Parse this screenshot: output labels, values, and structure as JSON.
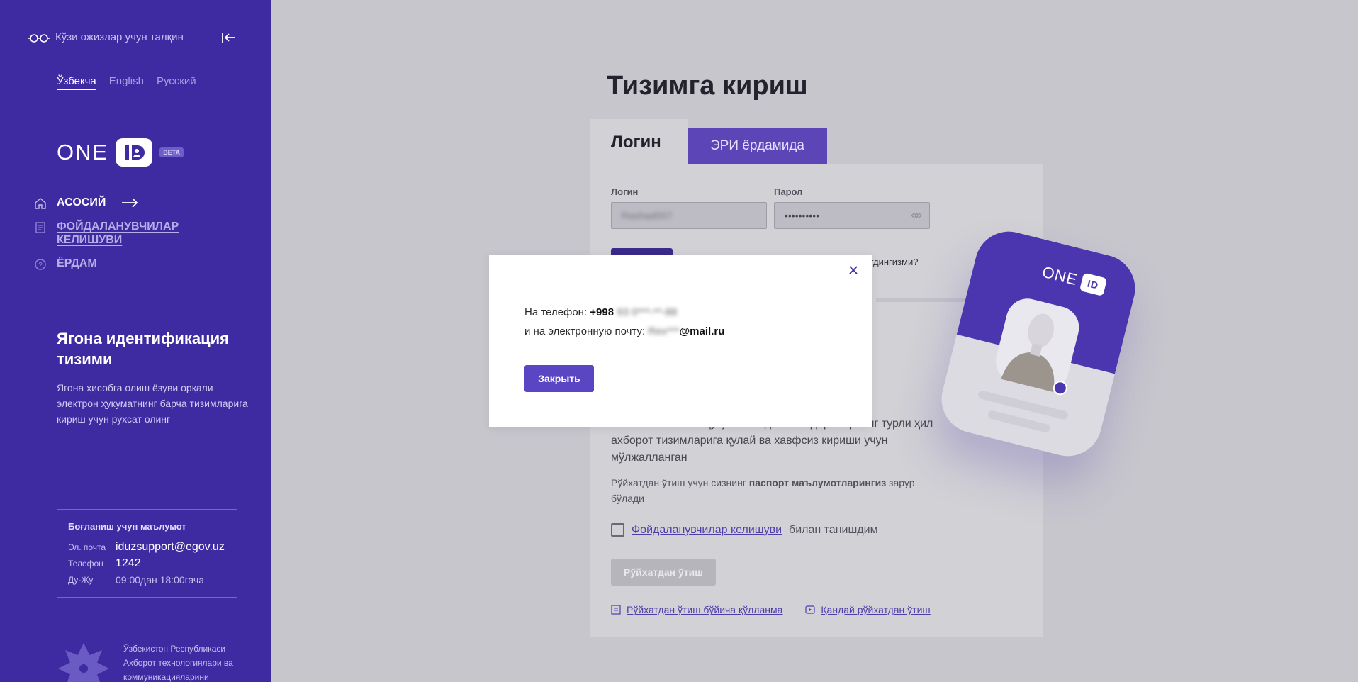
{
  "sidebar": {
    "accessibility_label": "Кўзи ожизлар учун талқин",
    "languages": [
      "Ўзбекча",
      "English",
      "Русский"
    ],
    "logo": {
      "text": "ONE",
      "badge": "BETA"
    },
    "nav": [
      {
        "label": "АСОСИЙ"
      },
      {
        "label": "ФОЙДАЛАНУВЧИЛАР КЕЛИШУВИ"
      },
      {
        "label": "ЁРДАМ"
      }
    ],
    "system_title": "Ягона идентификация тизими",
    "system_desc": "Ягона ҳисобга олиш ёзуви орқали электрон ҳукуматнинг барча тизимларига кириш учун рухсат олинг",
    "contact": {
      "title": "Боғланиш учун маълумот",
      "email_label": "Эл. почта",
      "email": "iduzsupport@egov.uz",
      "phone_label": "Телефон",
      "phone": "1242",
      "hours_label": "Ду-Жу",
      "hours": "09:00дан 18:00гача"
    },
    "ministry_text": "Ўзбекистон Республикаси Ахборот технологиялари ва коммуникацияларини"
  },
  "main": {
    "title": "Тизимга кириш",
    "tabs": [
      {
        "label": "Логин"
      },
      {
        "label": "ЭРИ ёрдамида"
      }
    ],
    "form": {
      "login_label": "Логин",
      "login_value": "Rashad007",
      "password_label": "Парол",
      "password_value": "••••••••••",
      "forgot_fragment": "утдингизми?"
    },
    "description": "…чининг электон ҳукумат ва давлат идораларнинг турли ҳил ахборот тизимларига қулай ва хавфсиз кириши учун мўлжалланган",
    "passport_note_prefix": "Рўйхатдан ўтиш учун сизнинг ",
    "passport_note_bold": "паспорт маълумотларингиз",
    "passport_note_suffix": " зарур бўлади",
    "agree_link": "Фойдаланувчилар келишуви",
    "agree_suffix": "билан танишдим",
    "register_button": "Рўйхатдан ўтиш",
    "links": [
      "Рўйхатдан ўтиш бўйича қўлланма",
      "Қандай рўйхатдан ўтиш"
    ],
    "card_logo": "ONE"
  },
  "modal": {
    "phone_prefix": "На телефон: ",
    "phone_visible": "+998",
    "phone_hidden": "93 0***-**-88",
    "email_prefix": "и на электронную почту: ",
    "email_hidden": "Rex***",
    "email_domain": "@mail.ru",
    "button": "Закрыть"
  }
}
